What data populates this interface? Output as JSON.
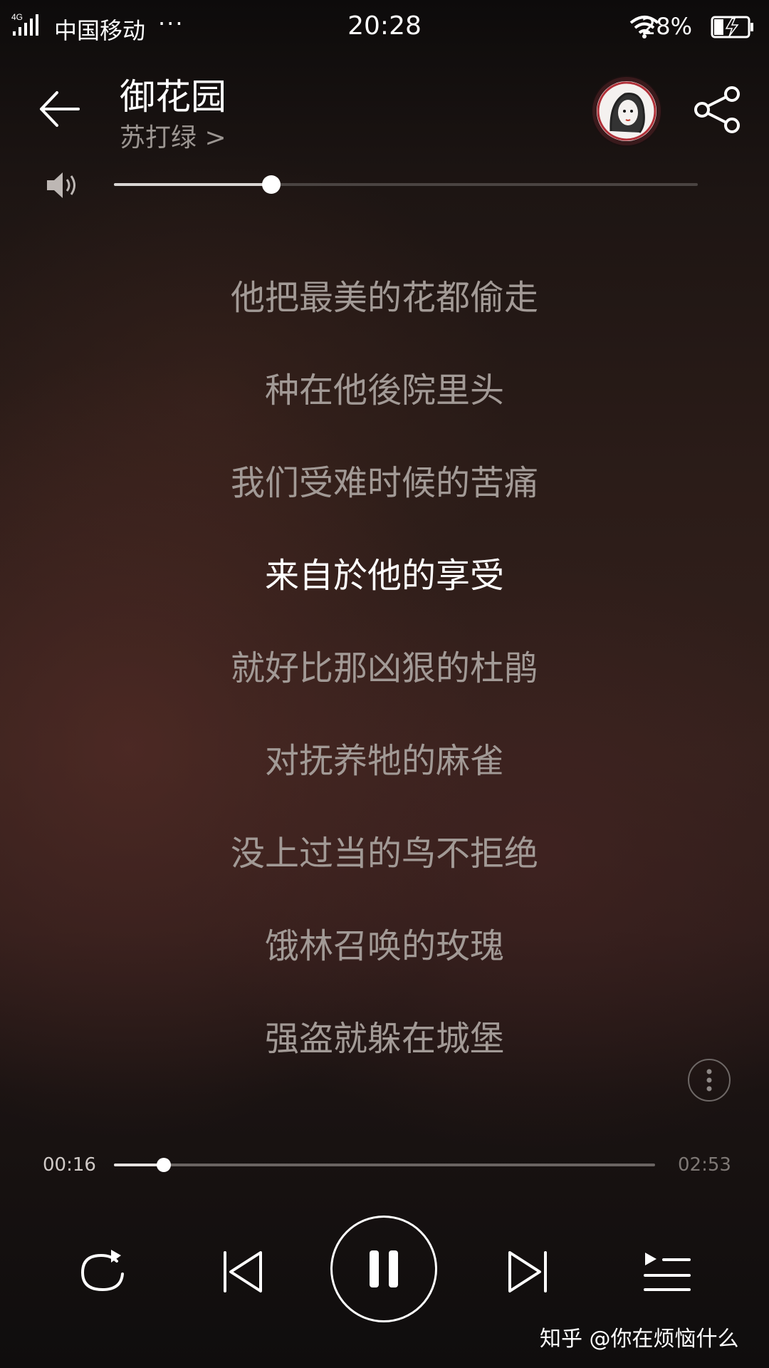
{
  "status_bar": {
    "network": "4G",
    "carrier": "中国移动",
    "overflow": "···",
    "time": "20:28",
    "battery": "28%",
    "battery_level": 0.28
  },
  "header": {
    "song_title": "御花园",
    "artist": "苏打绿 >",
    "icons": [
      "back-arrow-icon",
      "album-avatar",
      "share-icon"
    ]
  },
  "volume": {
    "level": 0.27
  },
  "lyrics": {
    "lines": [
      "他把最美的花都偷走",
      "种在他後院里头",
      "我们受难时候的苦痛",
      "来自於他的享受",
      "就好比那凶狠的杜鹃",
      "对抚养牠的麻雀",
      "没上过当的鸟不拒绝",
      "饿林召唤的玫瑰",
      "强盗就躲在城堡"
    ],
    "active_index": 3
  },
  "progress": {
    "current": "00:16",
    "total": "02:53",
    "fraction": 0.092
  },
  "controls": [
    "repeat-icon",
    "previous-icon",
    "pause-icon",
    "next-icon",
    "playlist-icon"
  ],
  "watermark": "知乎 @你在烦恼什么"
}
